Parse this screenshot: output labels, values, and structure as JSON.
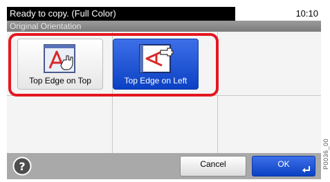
{
  "status": {
    "message": "Ready to copy. (Full Color)",
    "time": "10:10"
  },
  "screen": {
    "title": "Original Orientation"
  },
  "options": [
    {
      "label": "Top Edge on Top",
      "selected": false,
      "icon": "top-edge-on-top-icon"
    },
    {
      "label": "Top Edge on Left",
      "selected": true,
      "icon": "top-edge-on-left-icon"
    }
  ],
  "footer": {
    "cancel_label": "Cancel",
    "ok_label": "OK",
    "help_icon": "help-icon"
  },
  "side_code": "P0036_00",
  "colors": {
    "highlight": "#e5161f",
    "selected": "#0b41c4",
    "status_bar": "#000000"
  }
}
